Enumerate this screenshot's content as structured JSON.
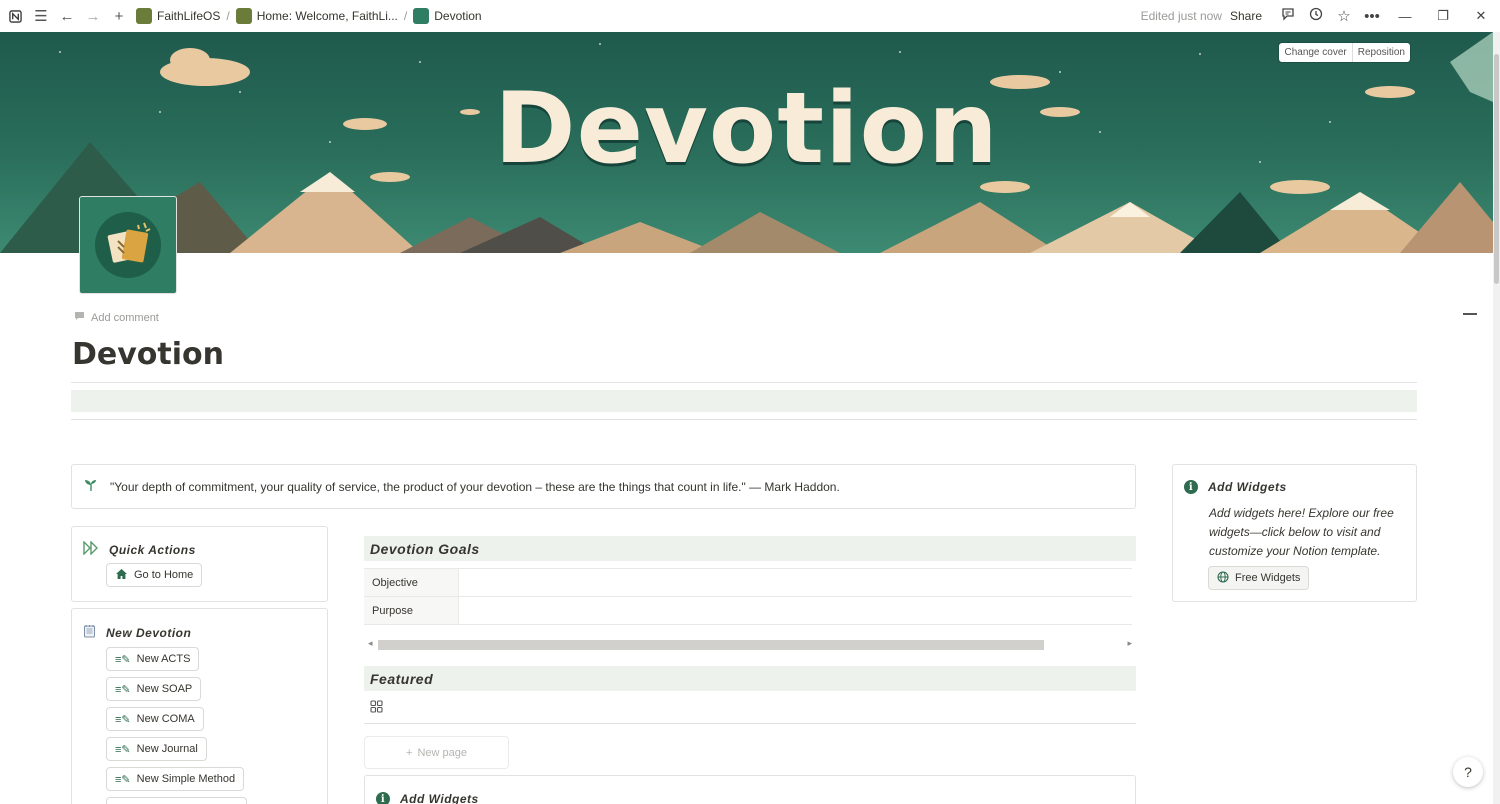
{
  "topbar": {
    "breadcrumbs": [
      {
        "label": "FaithLifeOS"
      },
      {
        "label": "Home: Welcome, FaithLi..."
      },
      {
        "label": "Devotion"
      }
    ],
    "edited": "Edited just now",
    "share": "Share"
  },
  "cover": {
    "title": "Devotion",
    "change_cover": "Change cover",
    "reposition": "Reposition"
  },
  "page": {
    "add_comment": "Add comment",
    "title": "Devotion"
  },
  "quote": {
    "text": "\"Your depth of commitment, your quality of service, the product of your devotion – these are the things that count in life.\" — Mark Haddon."
  },
  "widgets_card": {
    "title": "Add Widgets",
    "body": "Add widgets here! Explore our free widgets—click below to visit and customize your Notion template.",
    "button": "Free Widgets"
  },
  "quick_actions": {
    "title": "Quick Actions",
    "button": "Go to Home"
  },
  "new_devotion": {
    "title": "New Devotion",
    "buttons": [
      "New ACTS",
      "New SOAP",
      "New COMA",
      "New Journal",
      "New Simple Method"
    ]
  },
  "goals": {
    "title": "Devotion Goals",
    "rows": [
      {
        "label": "Objective",
        "value": ""
      },
      {
        "label": "Purpose",
        "value": ""
      }
    ]
  },
  "featured": {
    "title": "Featured",
    "new_page": "New page"
  },
  "bottom_widgets": {
    "title": "Add Widgets"
  },
  "colors": {
    "accent_green": "#2f6b4f",
    "section_bg": "#edf2ec",
    "cover_text": "#f8ecd8"
  }
}
